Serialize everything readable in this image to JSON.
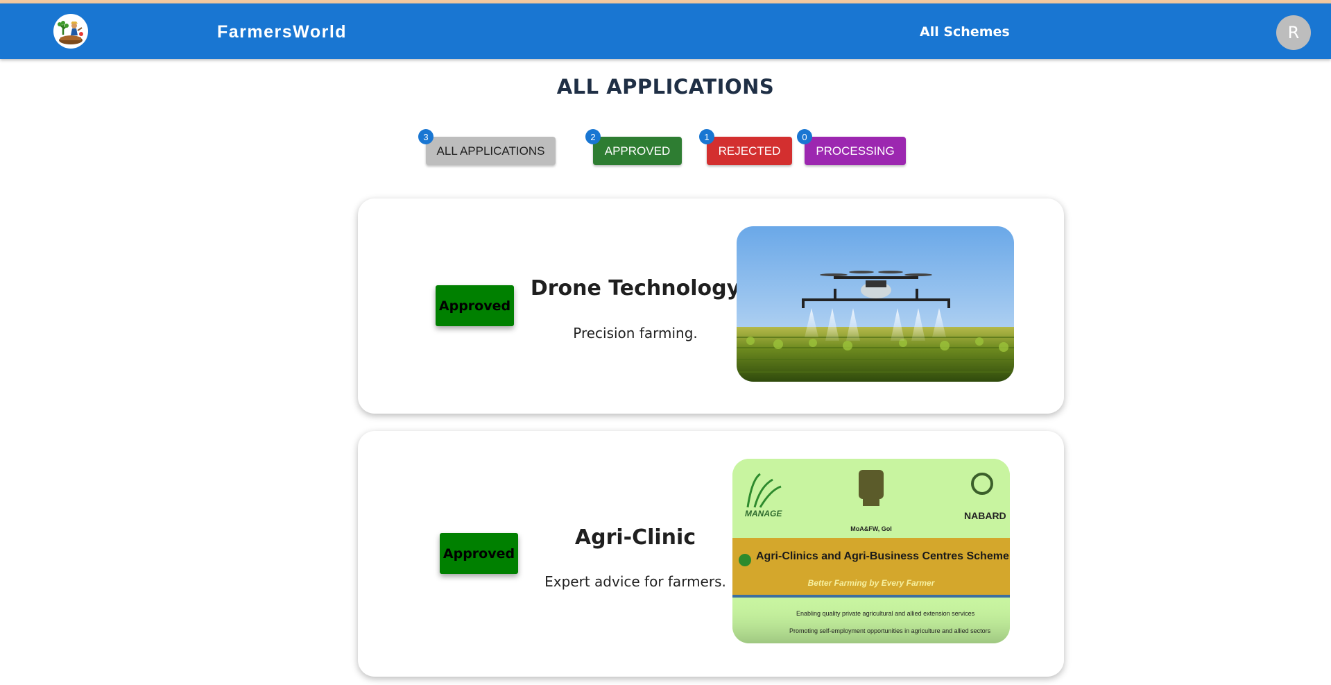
{
  "navbar": {
    "brand": "FarmersWorld",
    "link": "All Schemes",
    "avatar_initial": "R",
    "logo_icon": "farmer-logo-icon",
    "color": "#1976d2"
  },
  "page_title": "ALL APPLICATIONS",
  "filters": [
    {
      "label": "ALL APPLICATIONS",
      "count": "3",
      "color": "#bdbdbd"
    },
    {
      "label": "APPROVED",
      "count": "2",
      "color": "#2e7d32"
    },
    {
      "label": "REJECTED",
      "count": "1",
      "color": "#d32f2f"
    },
    {
      "label": "PROCESSING",
      "count": "0",
      "color": "#9c27b0"
    }
  ],
  "applications": [
    {
      "status": "Approved",
      "title": "Drone Technology",
      "description": "Precision farming."
    },
    {
      "status": "Approved",
      "title": "Agri-Clinic",
      "description": "Expert advice for farmers.",
      "image_text": {
        "org_left": "MANAGE",
        "org_center": "MoA&FW, GoI",
        "org_right": "NABARD",
        "banner": "Agri-Clinics and Agri-Business Centres Scheme (AC&ABC)",
        "tagline": "Better Farming by Every Farmer",
        "bullets": [
          "Enabling quality private agricultural and allied extension services",
          "Promoting self-employment opportunities in agriculture and allied sectors"
        ]
      }
    }
  ]
}
